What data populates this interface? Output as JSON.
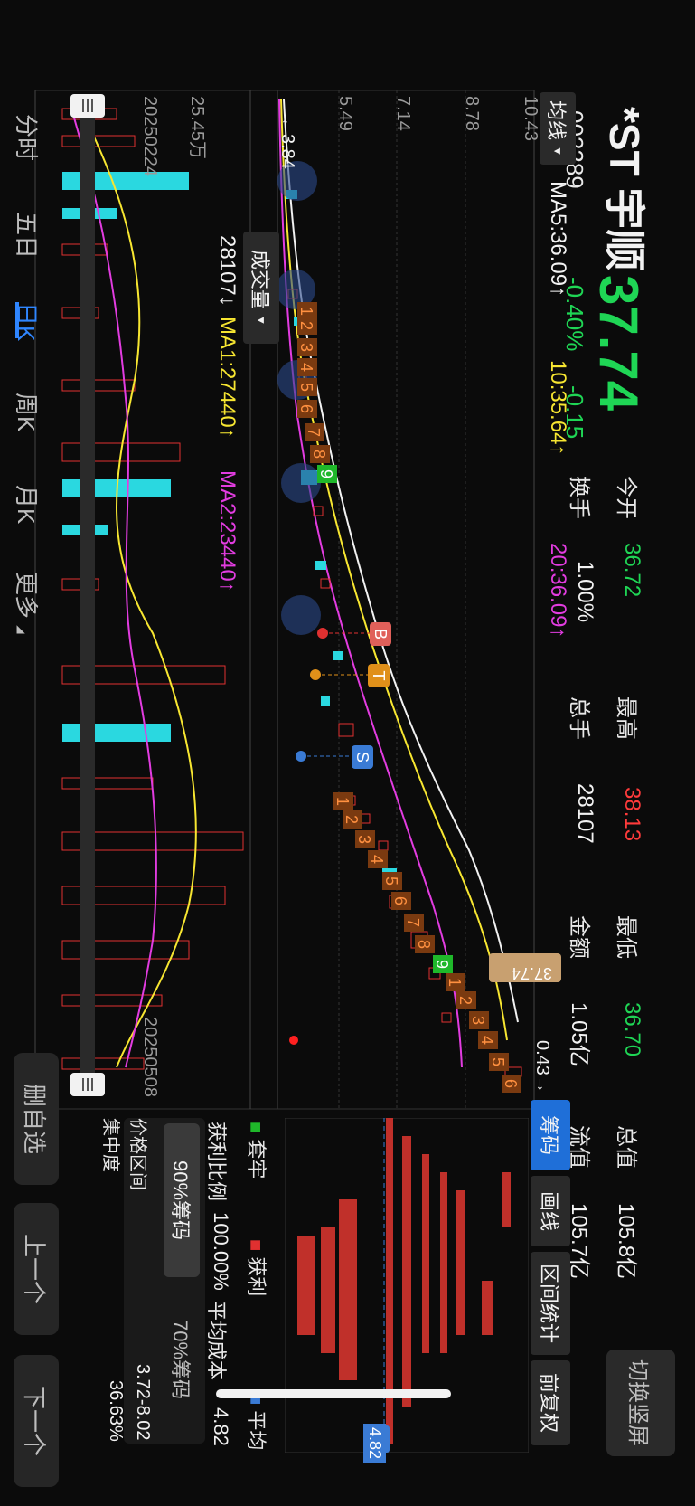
{
  "header": {
    "stock_name": "*ST 宇顺",
    "stock_code": "002289",
    "price": "37.74",
    "change_pct": "-0.40%",
    "change_amt": "-0.15",
    "switch_btn": "切换竖屏",
    "stats": [
      {
        "label": "今开",
        "value": "36.72",
        "color": "#1fd655"
      },
      {
        "label": "最高",
        "value": "38.13",
        "color": "#ff3b3b"
      },
      {
        "label": "最低",
        "value": "36.70",
        "color": "#1fd655"
      },
      {
        "label": "总值",
        "value": "105.8亿",
        "color": "#f2f2f2"
      },
      {
        "label": "换手",
        "value": "1.00%",
        "color": "#f2f2f2"
      },
      {
        "label": "总手",
        "value": "28107",
        "color": "#f2f2f2"
      },
      {
        "label": "金额",
        "value": "1.05亿",
        "color": "#f2f2f2"
      },
      {
        "label": "流值",
        "value": "105.7亿",
        "color": "#f2f2f2"
      }
    ]
  },
  "ma_bar": {
    "selector": "均线",
    "ma5": "MA5:36.09↑",
    "ma10": "10:35.64↑",
    "ma20": "20:36.09↑"
  },
  "chart": {
    "y_labels": [
      "10.43",
      "8.78",
      "7.14",
      "5.49",
      "3.84"
    ],
    "low_marker": "3.84",
    "current_price_tag": "37.74",
    "high_marker": "0.43",
    "markers": {
      "buy": "B",
      "t": "T",
      "sell": "S"
    },
    "seq_labels_a": [
      "1",
      "2",
      "3",
      "4",
      "5",
      "6",
      "7",
      "8",
      "9"
    ],
    "seq_labels_b": [
      "1",
      "2",
      "3",
      "4",
      "5",
      "6",
      "7",
      "8",
      "9"
    ],
    "seq_labels_c": [
      "1",
      "2",
      "3",
      "4",
      "5",
      "6"
    ]
  },
  "volume": {
    "selector": "成交量",
    "vol": "28107↓",
    "ma1": "MA1:27440↑",
    "ma2": "MA2:23440↑",
    "y_label": "25.45万",
    "start_date": "20250224",
    "end_date": "20250508"
  },
  "chips": {
    "tabs": [
      "筹码",
      "画线",
      "区间统计",
      "前复权"
    ],
    "avg_tag": "4.82",
    "legend": [
      {
        "label": "套牢",
        "color": "#1fb82a"
      },
      {
        "label": "获利",
        "color": "#e03030"
      },
      {
        "label": "平均",
        "color": "#3a7bd5"
      }
    ],
    "profit_ratio_label": "获利比例",
    "profit_ratio": "100.00%",
    "avg_cost_label": "平均成本",
    "avg_cost": "4.82",
    "chip_tabs": [
      "90%筹码",
      "70%筹码"
    ],
    "range_label": "价格区间",
    "range_value": "3.72-8.02",
    "conc_label": "集中度",
    "conc_value": "36.63%"
  },
  "bottom_tabs": [
    "分时",
    "五日",
    "日K",
    "周K",
    "月K",
    "更多"
  ],
  "bottom_buttons": [
    "删自选",
    "上一个",
    "下一个"
  ]
}
